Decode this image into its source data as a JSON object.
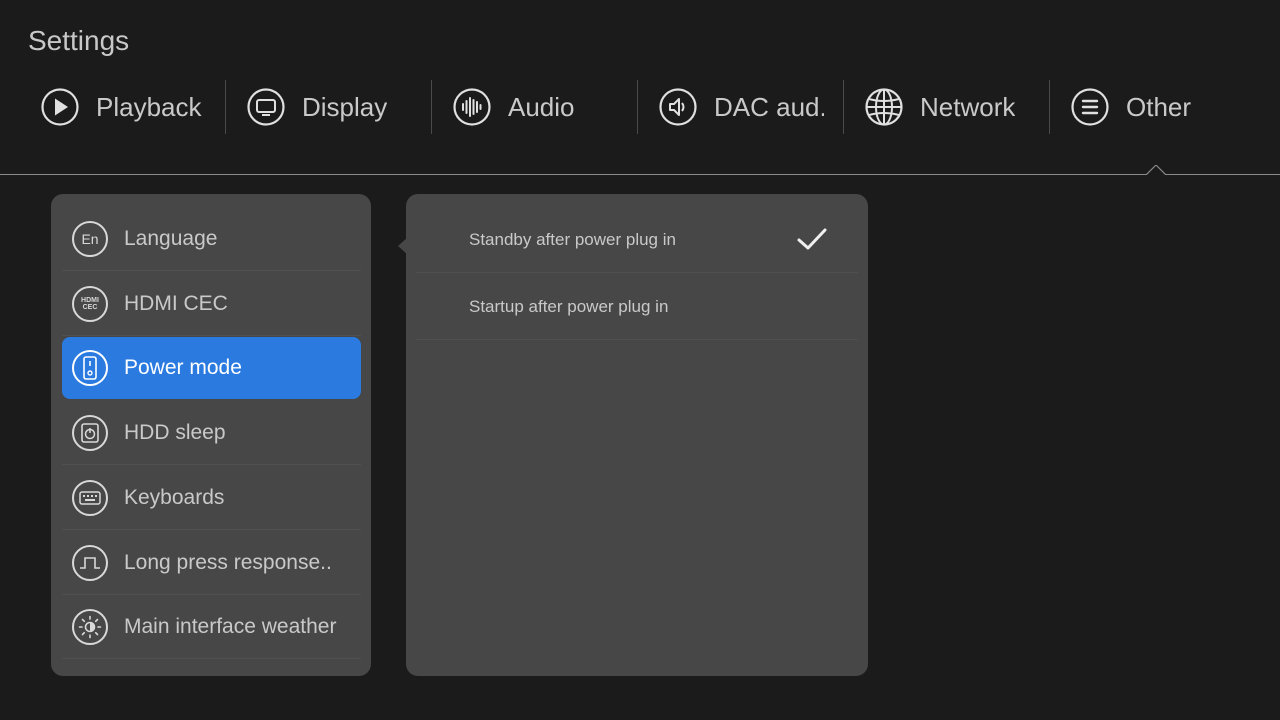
{
  "header": {
    "title": "Settings"
  },
  "tabs": [
    {
      "label": "Playback",
      "icon": "play-icon"
    },
    {
      "label": "Display",
      "icon": "monitor-icon"
    },
    {
      "label": "Audio",
      "icon": "waveform-icon"
    },
    {
      "label": "DAC aud..",
      "icon": "speaker-icon"
    },
    {
      "label": "Network",
      "icon": "globe-icon"
    },
    {
      "label": "Other",
      "icon": "menu-icon",
      "active": true
    }
  ],
  "menu": {
    "items": [
      {
        "label": "Language",
        "icon": "language-icon",
        "icon_text": "En"
      },
      {
        "label": "HDMI CEC",
        "icon": "hdmi-cec-icon",
        "icon_text": "HDMI CEC"
      },
      {
        "label": "Power mode",
        "icon": "power-mode-icon",
        "selected": true
      },
      {
        "label": "HDD sleep",
        "icon": "hdd-sleep-icon"
      },
      {
        "label": "Keyboards",
        "icon": "keyboard-icon"
      },
      {
        "label": "Long press response..",
        "icon": "pulse-icon"
      },
      {
        "label": "Main interface weather",
        "icon": "weather-sun-icon"
      }
    ]
  },
  "options": {
    "items": [
      {
        "label": "Standby after power plug in",
        "checked": true
      },
      {
        "label": "Startup after power plug in",
        "checked": false
      }
    ]
  },
  "colors": {
    "background": "#1b1b1b",
    "panel": "#474747",
    "accent": "#2a7ae0"
  }
}
